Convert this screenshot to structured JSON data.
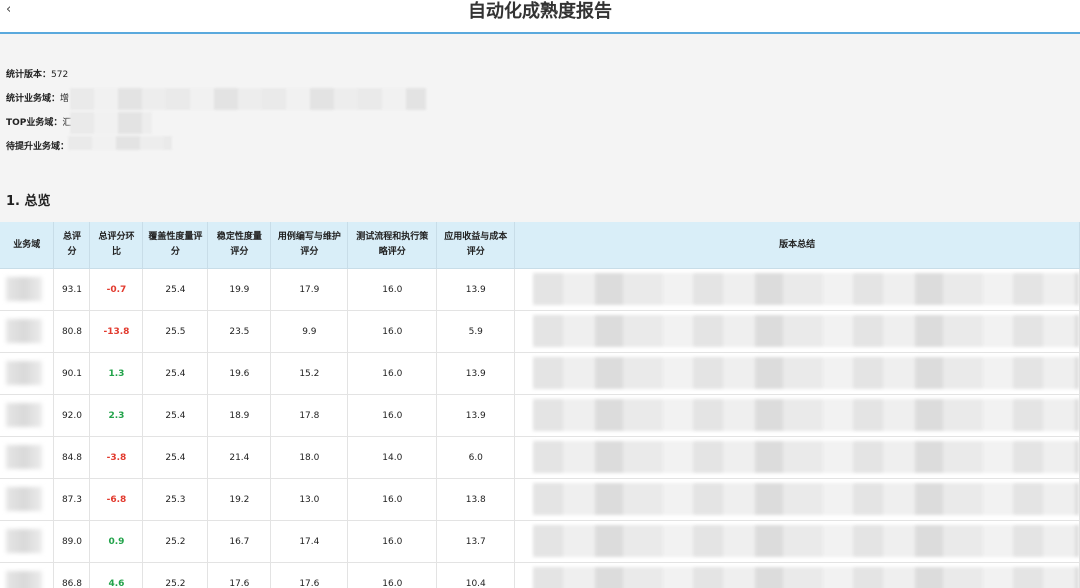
{
  "header": {
    "back_glyph": "‹",
    "title": "自动化成熟度报告"
  },
  "info": {
    "version_label": "统计版本：",
    "version_value": "572",
    "domain_label": "统计业务域：",
    "domain_value": "增",
    "top_label": "TOP业务域：",
    "top_value": "汇",
    "improve_label": "待提升业务域：",
    "improve_value": ""
  },
  "section": {
    "title": "1. 总览"
  },
  "table": {
    "columns": [
      "业务域",
      "总评分",
      "总评分环比",
      "覆盖性度量评分",
      "稳定性度量评分",
      "用例编写与维护评分",
      "测试流程和执行策略评分",
      "应用收益与成本评分",
      "版本总结"
    ],
    "rows": [
      {
        "total": "93.1",
        "delta": "-0.7",
        "trend": "neg",
        "coverage": "25.4",
        "stability": "19.9",
        "authoring": "17.9",
        "process": "16.0",
        "benefit": "13.9"
      },
      {
        "total": "80.8",
        "delta": "-13.8",
        "trend": "neg",
        "coverage": "25.5",
        "stability": "23.5",
        "authoring": "9.9",
        "process": "16.0",
        "benefit": "5.9"
      },
      {
        "total": "90.1",
        "delta": "1.3",
        "trend": "pos",
        "coverage": "25.4",
        "stability": "19.6",
        "authoring": "15.2",
        "process": "16.0",
        "benefit": "13.9"
      },
      {
        "total": "92.0",
        "delta": "2.3",
        "trend": "pos",
        "coverage": "25.4",
        "stability": "18.9",
        "authoring": "17.8",
        "process": "16.0",
        "benefit": "13.9"
      },
      {
        "total": "84.8",
        "delta": "-3.8",
        "trend": "neg",
        "coverage": "25.4",
        "stability": "21.4",
        "authoring": "18.0",
        "process": "14.0",
        "benefit": "6.0"
      },
      {
        "total": "87.3",
        "delta": "-6.8",
        "trend": "neg",
        "coverage": "25.3",
        "stability": "19.2",
        "authoring": "13.0",
        "process": "16.0",
        "benefit": "13.8"
      },
      {
        "total": "89.0",
        "delta": "0.9",
        "trend": "pos",
        "coverage": "25.2",
        "stability": "16.7",
        "authoring": "17.4",
        "process": "16.0",
        "benefit": "13.7"
      },
      {
        "total": "86.8",
        "delta": "4.6",
        "trend": "pos",
        "coverage": "25.2",
        "stability": "17.6",
        "authoring": "17.6",
        "process": "16.0",
        "benefit": "10.4"
      }
    ]
  },
  "colors": {
    "header_bg": "#d9eef8",
    "accent_line": "#5aa9dd",
    "negative": "#e23a2e",
    "positive": "#22a34a"
  }
}
